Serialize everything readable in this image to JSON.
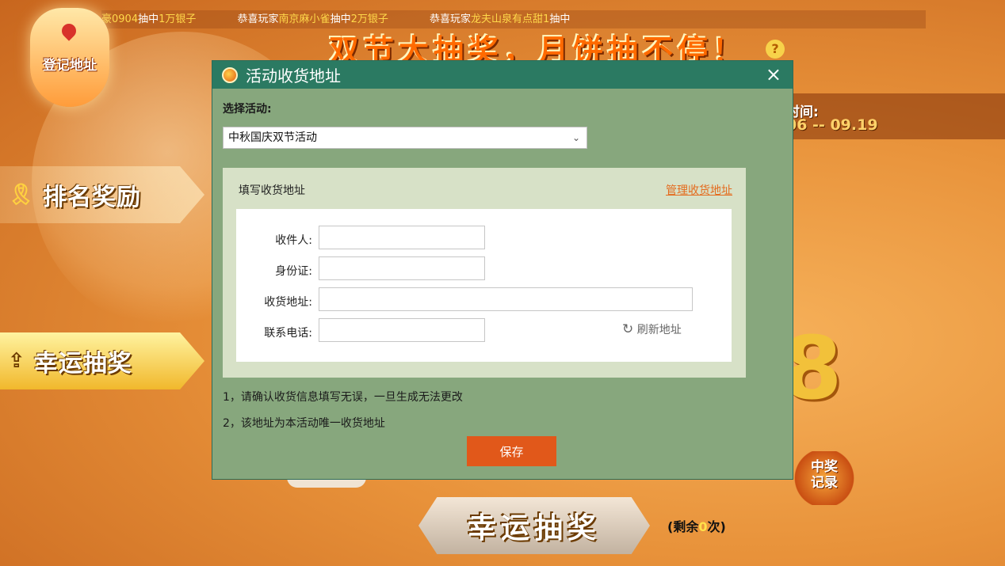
{
  "ticker": {
    "items": [
      {
        "prefix": "",
        "player": "豪0904",
        "mid": "抽中",
        "amount": "1万银子",
        "suffix": ""
      },
      {
        "prefix": "恭喜玩家",
        "player": "南京麻小雀",
        "mid": "抽中",
        "amount": "2万银子",
        "suffix": ""
      },
      {
        "prefix": "恭喜玩家",
        "player": "龙夫山泉有点甜",
        "mid": "",
        "amount": "1",
        "suffix": "抽中"
      }
    ]
  },
  "banner": {
    "title": "双节大抽奖，月饼抽不停！",
    "help_glyph": "?"
  },
  "lantern": {
    "label": "登记地址"
  },
  "side": {
    "rank_label": "排名奖励",
    "lucky_label": "幸运抽奖"
  },
  "activity_time": {
    "label": "时间:",
    "value": "06 -- 09.19"
  },
  "decor": {
    "big_digit": "8"
  },
  "record_button": {
    "line1": "中奖",
    "line2": "记录"
  },
  "lottery": {
    "main_label": "幸运抽奖",
    "remain_prefix": "(剩余",
    "remain_count": "0",
    "remain_suffix": "次)"
  },
  "dialog": {
    "title": "活动收货地址",
    "close_glyph": "×",
    "select_label": "选择活动:",
    "selected_activity": "中秋国庆双节活动",
    "panel_title": "填写收货地址",
    "manage_link": "管理收货地址",
    "fields": {
      "recipient_label": "收件人:",
      "id_label": "身份证:",
      "address_label": "收货地址:",
      "phone_label": "联系电话:",
      "recipient_value": "",
      "id_value": "",
      "address_value": "",
      "phone_value": ""
    },
    "refresh_label": "刷新地址",
    "notes": [
      "1，请确认收货信息填写无误，一旦生成无法更改",
      "2，该地址为本活动唯一收货地址"
    ],
    "save_label": "保存"
  },
  "colors": {
    "dialog_header": "#2b7a62",
    "dialog_body": "#87a77d",
    "panel_bg": "#d7e1c7",
    "accent": "#e1581a",
    "link": "#e46b1e"
  }
}
